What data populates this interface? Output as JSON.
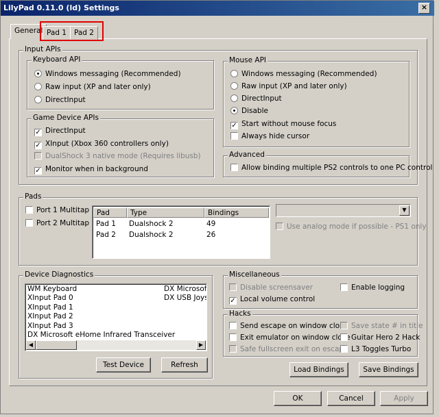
{
  "window": {
    "title": "LilyPad 0.11.0 (ld) Settings",
    "close_glyph": "×"
  },
  "tabs": [
    "General",
    "Pad 1",
    "Pad 2"
  ],
  "input_apis": {
    "label": "Input APIs",
    "keyboard": {
      "label": "Keyboard API",
      "options": [
        "Windows messaging (Recommended)",
        "Raw input (XP and later only)",
        "DirectInput"
      ],
      "selected": 0
    },
    "game_device": {
      "label": "Game Device APIs",
      "items": [
        {
          "label": "DirectInput",
          "checked": true,
          "enabled": true
        },
        {
          "label": "XInput (Xbox 360 controllers only)",
          "checked": true,
          "enabled": true
        },
        {
          "label": "DualShock 3 native mode (Requires libusb)",
          "checked": false,
          "enabled": false
        },
        {
          "label": "Monitor when in background",
          "checked": true,
          "enabled": true
        }
      ]
    },
    "mouse": {
      "label": "Mouse API",
      "options": [
        "Windows messaging (Recommended)",
        "Raw input (XP and later only)",
        "DirectInput",
        "Disable"
      ],
      "selected": 3,
      "checks": [
        {
          "label": "Start without mouse focus",
          "checked": true
        },
        {
          "label": "Always hide cursor",
          "checked": false
        }
      ]
    },
    "advanced": {
      "label": "Advanced",
      "items": [
        {
          "label": "Allow binding multiple PS2 controls to one PC control",
          "checked": false
        }
      ]
    }
  },
  "pads": {
    "label": "Pads",
    "multitap": [
      {
        "label": "Port 1 Multitap",
        "checked": false
      },
      {
        "label": "Port 2 Multitap",
        "checked": false
      }
    ],
    "columns": [
      "Pad",
      "Type",
      "Bindings"
    ],
    "rows": [
      [
        "Pad 1",
        "Dualshock 2",
        "49"
      ],
      [
        "Pad 2",
        "Dualshock 2",
        "26"
      ]
    ],
    "analog_label": "Use analog mode if possible - PS1 only"
  },
  "diagnostics": {
    "label": "Device Diagnostics",
    "col1": [
      "WM Keyboard",
      "XInput Pad 0",
      "XInput Pad 1",
      "XInput Pad 2",
      "XInput Pad 3",
      "DX Microsoft eHome Infrared Transceiver"
    ],
    "col2": [
      "DX Microsoft e",
      "DX USB Joysti"
    ],
    "test_label": "Test Device",
    "refresh_label": "Refresh"
  },
  "misc": {
    "label": "Miscellaneous",
    "items": [
      {
        "label": "Disable screensaver",
        "checked": false,
        "enabled": false
      },
      {
        "label": "Enable logging",
        "checked": false,
        "enabled": true
      },
      {
        "label": "Local volume control",
        "checked": true,
        "enabled": true
      }
    ]
  },
  "hacks": {
    "label": "Hacks",
    "items": [
      {
        "label": "Send escape on window close",
        "checked": false,
        "enabled": true
      },
      {
        "label": "Save state # in title",
        "checked": false,
        "enabled": false
      },
      {
        "label": "Exit emulator on window close",
        "checked": false,
        "enabled": true
      },
      {
        "label": "Guitar Hero 2 Hack",
        "checked": false,
        "enabled": true
      },
      {
        "label": "Safe fullscreen exit on escape",
        "checked": false,
        "enabled": false
      },
      {
        "label": "L3 Toggles Turbo",
        "checked": false,
        "enabled": true
      }
    ]
  },
  "buttons": {
    "load": "Load Bindings",
    "save": "Save Bindings",
    "ok": "OK",
    "cancel": "Cancel",
    "apply": "Apply"
  },
  "colors": {
    "highlight": "#e00000",
    "title_bar": "#0a246a"
  }
}
